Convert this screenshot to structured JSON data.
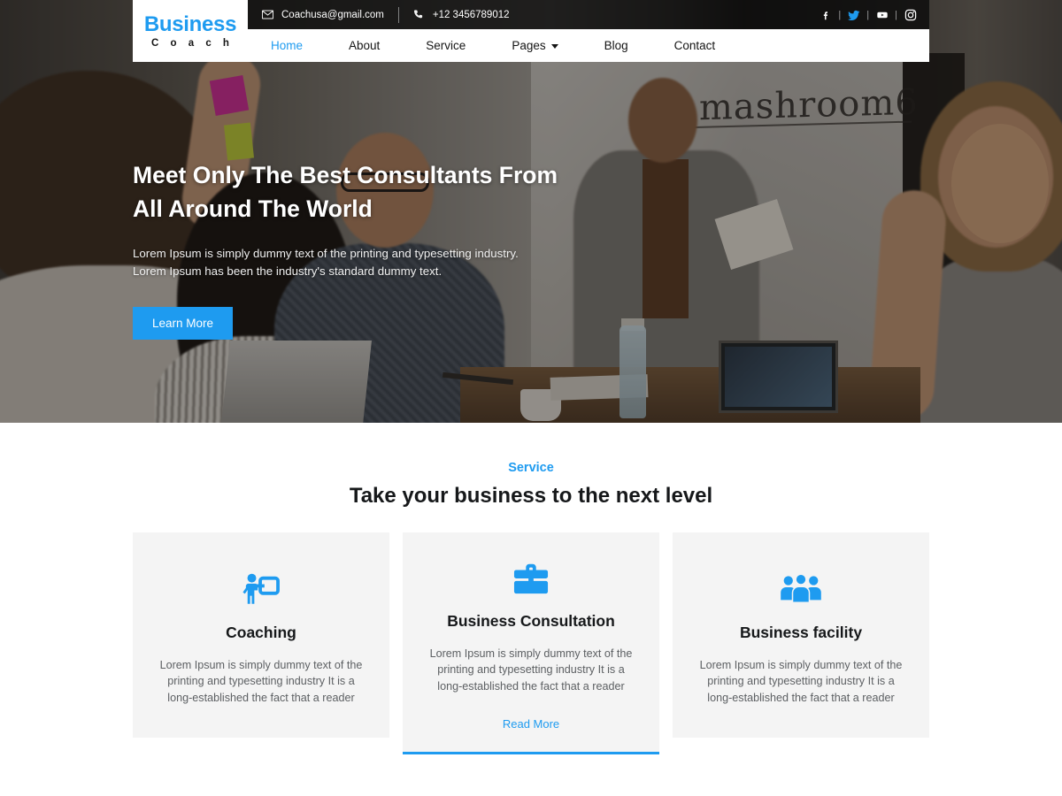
{
  "brand": {
    "name_top": "Business",
    "name_bottom": "C o a c h",
    "accent": "#1E9BF0"
  },
  "topbar": {
    "email": "Coachusa@gmail.com",
    "phone": "+12 3456789012",
    "email_icon": "envelope-icon",
    "phone_icon": "phone-icon",
    "separator": "|",
    "social": [
      {
        "name": "facebook-icon",
        "label": "f"
      },
      {
        "name": "twitter-icon",
        "label": "Twitter"
      },
      {
        "name": "youtube-icon",
        "label": "YouTube"
      },
      {
        "name": "instagram-icon",
        "label": "Instagram"
      }
    ]
  },
  "nav": {
    "items": [
      {
        "label": "Home",
        "active": true
      },
      {
        "label": "About",
        "active": false
      },
      {
        "label": "Service",
        "active": false
      },
      {
        "label": "Pages",
        "active": false,
        "has_dropdown": true
      },
      {
        "label": "Blog",
        "active": false
      },
      {
        "label": "Contact",
        "active": false
      }
    ]
  },
  "hero": {
    "title_line1": "Meet Only The Best Consultants From",
    "title_line2": "All Around The World",
    "subtitle_line1": "Lorem Ipsum is simply dummy text of the printing and typesetting industry.",
    "subtitle_line2": "Lorem Ipsum has been the industry's standard dummy text.",
    "cta_label": "Learn More",
    "background_sign_text": "mashroom6"
  },
  "service": {
    "eyebrow": "Service",
    "title": "Take your business to the next level",
    "cards": [
      {
        "icon": "chalkboard-teacher-icon",
        "title": "Coaching",
        "text": "Lorem Ipsum is simply dummy text of the printing and typesetting industry It is a long-established the fact that a reader",
        "featured": false
      },
      {
        "icon": "briefcase-icon",
        "title": "Business Consultation",
        "text": "Lorem Ipsum is simply dummy text of the printing and typesetting industry It is a long-established the fact that a reader",
        "featured": true,
        "link_label": "Read More"
      },
      {
        "icon": "users-group-icon",
        "title": "Business facility",
        "text": "Lorem Ipsum is simply dummy text of the printing and typesetting industry It is a long-established the fact that a reader",
        "featured": false
      }
    ]
  }
}
